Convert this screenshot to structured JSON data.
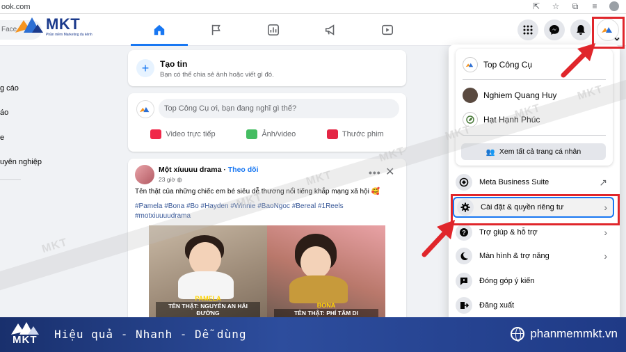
{
  "browser": {
    "url": "ook.com",
    "icons": [
      "share-icon",
      "star-icon",
      "extensions-icon",
      "tab-list-icon",
      "profile-icon"
    ]
  },
  "header": {
    "search_placeholder": "Face",
    "logo_text": "MKT",
    "logo_sub": "Phần mềm Marketing đa kênh",
    "nav_tabs": [
      "home-icon",
      "pages-icon",
      "ads-manager-icon",
      "ad-center-icon",
      "video-icon"
    ],
    "right_icons": [
      "menu-grid-icon",
      "messenger-icon",
      "notifications-icon",
      "account-icon"
    ]
  },
  "left_sidebar": {
    "items": [
      "g cáo",
      "áo",
      "e",
      "uyên nghiệp"
    ]
  },
  "story": {
    "title": "Tạo tin",
    "subtitle": "Bạn có thể chia sẻ ảnh hoặc viết gì đó."
  },
  "composer": {
    "placeholder": "Top Công Cụ ơi, bạn đang nghĩ gì thế?",
    "actions": [
      "Video trực tiếp",
      "Ảnh/video",
      "Thước phim"
    ],
    "action_colors": [
      "#f02849",
      "#45bd62",
      "#e42645"
    ]
  },
  "post": {
    "author": "Một xíuuuu drama",
    "follow": "Theo dõi",
    "time": "23 giờ",
    "text": "Tên thật của những chiếc em bé siêu dễ thương nổi tiếng khắp mạng xã hội 🥰",
    "tags": "#Pamela #Bona #Bo #Hayden #Winnie #BaoNgoc #Bereal #1Reels #motxiuuuudrama",
    "images": [
      {
        "name": "PAMELA",
        "real": "TÊN THẬT: NGUYỄN AN HẢI ĐƯỜNG"
      },
      {
        "name": "BONA",
        "real": "TÊN THẬT: PHÍ TÂM DI"
      }
    ]
  },
  "dropdown": {
    "profiles": [
      "Top Công Cụ",
      "Nghiem Quang Huy",
      "Hạt Hạnh Phúc"
    ],
    "see_all": "Xem tất cả trang cá nhân",
    "menu": [
      {
        "label": "Meta Business Suite",
        "icon": "business-suite-icon",
        "arrow": "↗"
      },
      {
        "label": "Cài đặt & quyền riêng tư",
        "icon": "gear-icon",
        "arrow": "›"
      },
      {
        "label": "Trợ giúp & hỗ trợ",
        "icon": "help-icon",
        "arrow": "›"
      },
      {
        "label": "Màn hình & trợ năng",
        "icon": "moon-icon",
        "arrow": "›"
      },
      {
        "label": "Đóng góp ý kiến",
        "icon": "feedback-icon",
        "arrow": ""
      },
      {
        "label": "Đăng xuất",
        "icon": "logout-icon",
        "arrow": ""
      }
    ]
  },
  "watermark": "MKT",
  "banner": {
    "logo_text": "MKT",
    "slogan": "Hiệu quả - Nhanh  - Dễ dùng",
    "website": "phanmemmkt.vn"
  },
  "colors": {
    "facebook_blue": "#1877f2",
    "highlight_red": "#e0262b",
    "banner_blue": "#1f3a86"
  }
}
